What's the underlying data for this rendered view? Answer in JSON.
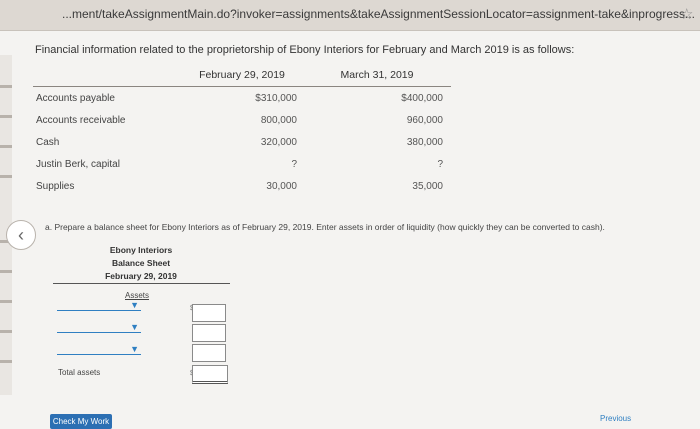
{
  "browser": {
    "url": "...ment/takeAssignmentMain.do?invoker=assignments&takeAssignmentSessionLocator=assignment-take&inprogress..."
  },
  "intro": "Financial information related to the proprietorship of Ebony Interiors for February and March 2019 is as follows:",
  "table": {
    "col1": "February 29, 2019",
    "col2": "March 31, 2019",
    "rows": [
      {
        "label": "Accounts payable",
        "feb": "$310,000",
        "mar": "$400,000"
      },
      {
        "label": "Accounts receivable",
        "feb": "800,000",
        "mar": "960,000"
      },
      {
        "label": "Cash",
        "feb": "320,000",
        "mar": "380,000"
      },
      {
        "label": "Justin Berk, capital",
        "feb": "?",
        "mar": "?"
      },
      {
        "label": "Supplies",
        "feb": "30,000",
        "mar": "35,000"
      }
    ]
  },
  "question": "a. Prepare a balance sheet for Ebony Interiors as of February 29, 2019. Enter assets in order of liquidity (how quickly they can be converted to cash).",
  "balance_sheet": {
    "company": "Ebony Interiors",
    "title": "Balance Sheet",
    "date": "February 29, 2019",
    "assets_label": "Assets",
    "dollar_sign": "$",
    "total_label": "Total assets"
  },
  "buttons": {
    "check": "Check My Work",
    "previous": "Previous"
  }
}
